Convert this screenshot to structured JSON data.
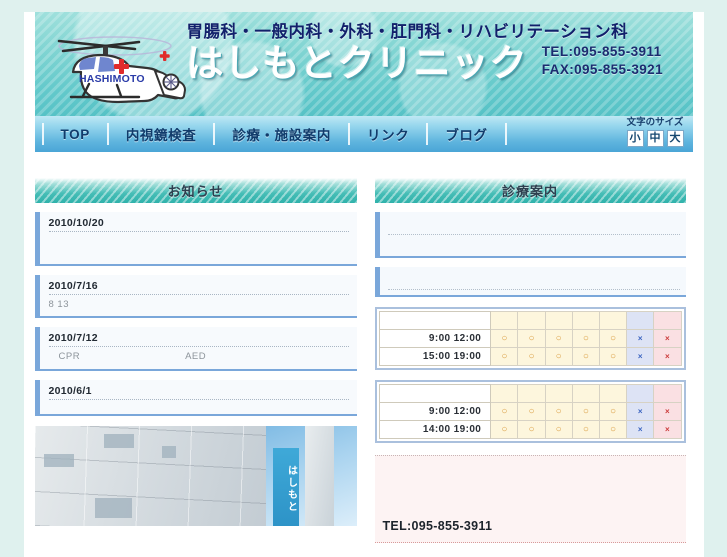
{
  "header": {
    "departments": "胃腸科・一般内科・外科・肛門科・リハビリテーション科",
    "clinic_name": "はしもとクリニック",
    "tel": "TEL:095-855-3911",
    "fax": "FAX:095-855-3921",
    "logo_text": "HASHIMOTO",
    "logo_icon": "helicopter-icon"
  },
  "nav": {
    "items": [
      {
        "label": "TOP"
      },
      {
        "label": "内視鏡検査"
      },
      {
        "label": "診療・施設案内"
      },
      {
        "label": "リンク"
      },
      {
        "label": "ブログ"
      }
    ],
    "fontsize": {
      "label": "文字のサイズ",
      "small": "小",
      "medium": "中",
      "large": "大"
    }
  },
  "news": {
    "title": "お知らせ",
    "items": [
      {
        "date": "2010/10/20",
        "body": "",
        "body2": ""
      },
      {
        "date": "2010/7/16",
        "body": "8 13",
        "body2": ""
      },
      {
        "date": "2010/7/12",
        "body": "CPR",
        "body2": "AED"
      },
      {
        "date": "2010/6/1",
        "body": "",
        "body2": ""
      }
    ],
    "photo_banner": "はしもと"
  },
  "guide": {
    "title": "診療案内",
    "rows": [
      {
        "text": ""
      },
      {
        "text": ""
      }
    ],
    "schedules": [
      {
        "header": [
          "",
          "",
          "",
          "",
          "",
          "",
          "",
          ""
        ],
        "rows": [
          {
            "label": "9:00  12:00",
            "marks": [
              "○",
              "○",
              "○",
              "○",
              "○",
              "×",
              "×"
            ]
          },
          {
            "label": "15:00  19:00",
            "marks": [
              "○",
              "○",
              "○",
              "○",
              "○",
              "×",
              "×"
            ]
          }
        ]
      },
      {
        "header": [
          "",
          "",
          "",
          "",
          "",
          "",
          "",
          ""
        ],
        "rows": [
          {
            "label": "9:00  12:00",
            "marks": [
              "○",
              "○",
              "○",
              "○",
              "○",
              "×",
              "×"
            ]
          },
          {
            "label": "14:00  19:00",
            "marks": [
              "○",
              "○",
              "○",
              "○",
              "○",
              "×",
              "×"
            ]
          }
        ]
      }
    ],
    "tel": "TEL:095-855-3911"
  },
  "colors": {
    "page_bg": "#dff1ee",
    "header_teal": "#63c9cb",
    "nav_blue": "#5eb4de",
    "accent_blue": "#7aa7da",
    "sat_blue": "#dde3f5",
    "sun_pink": "#fae0e3",
    "cell_cream": "#fdf6dd"
  }
}
